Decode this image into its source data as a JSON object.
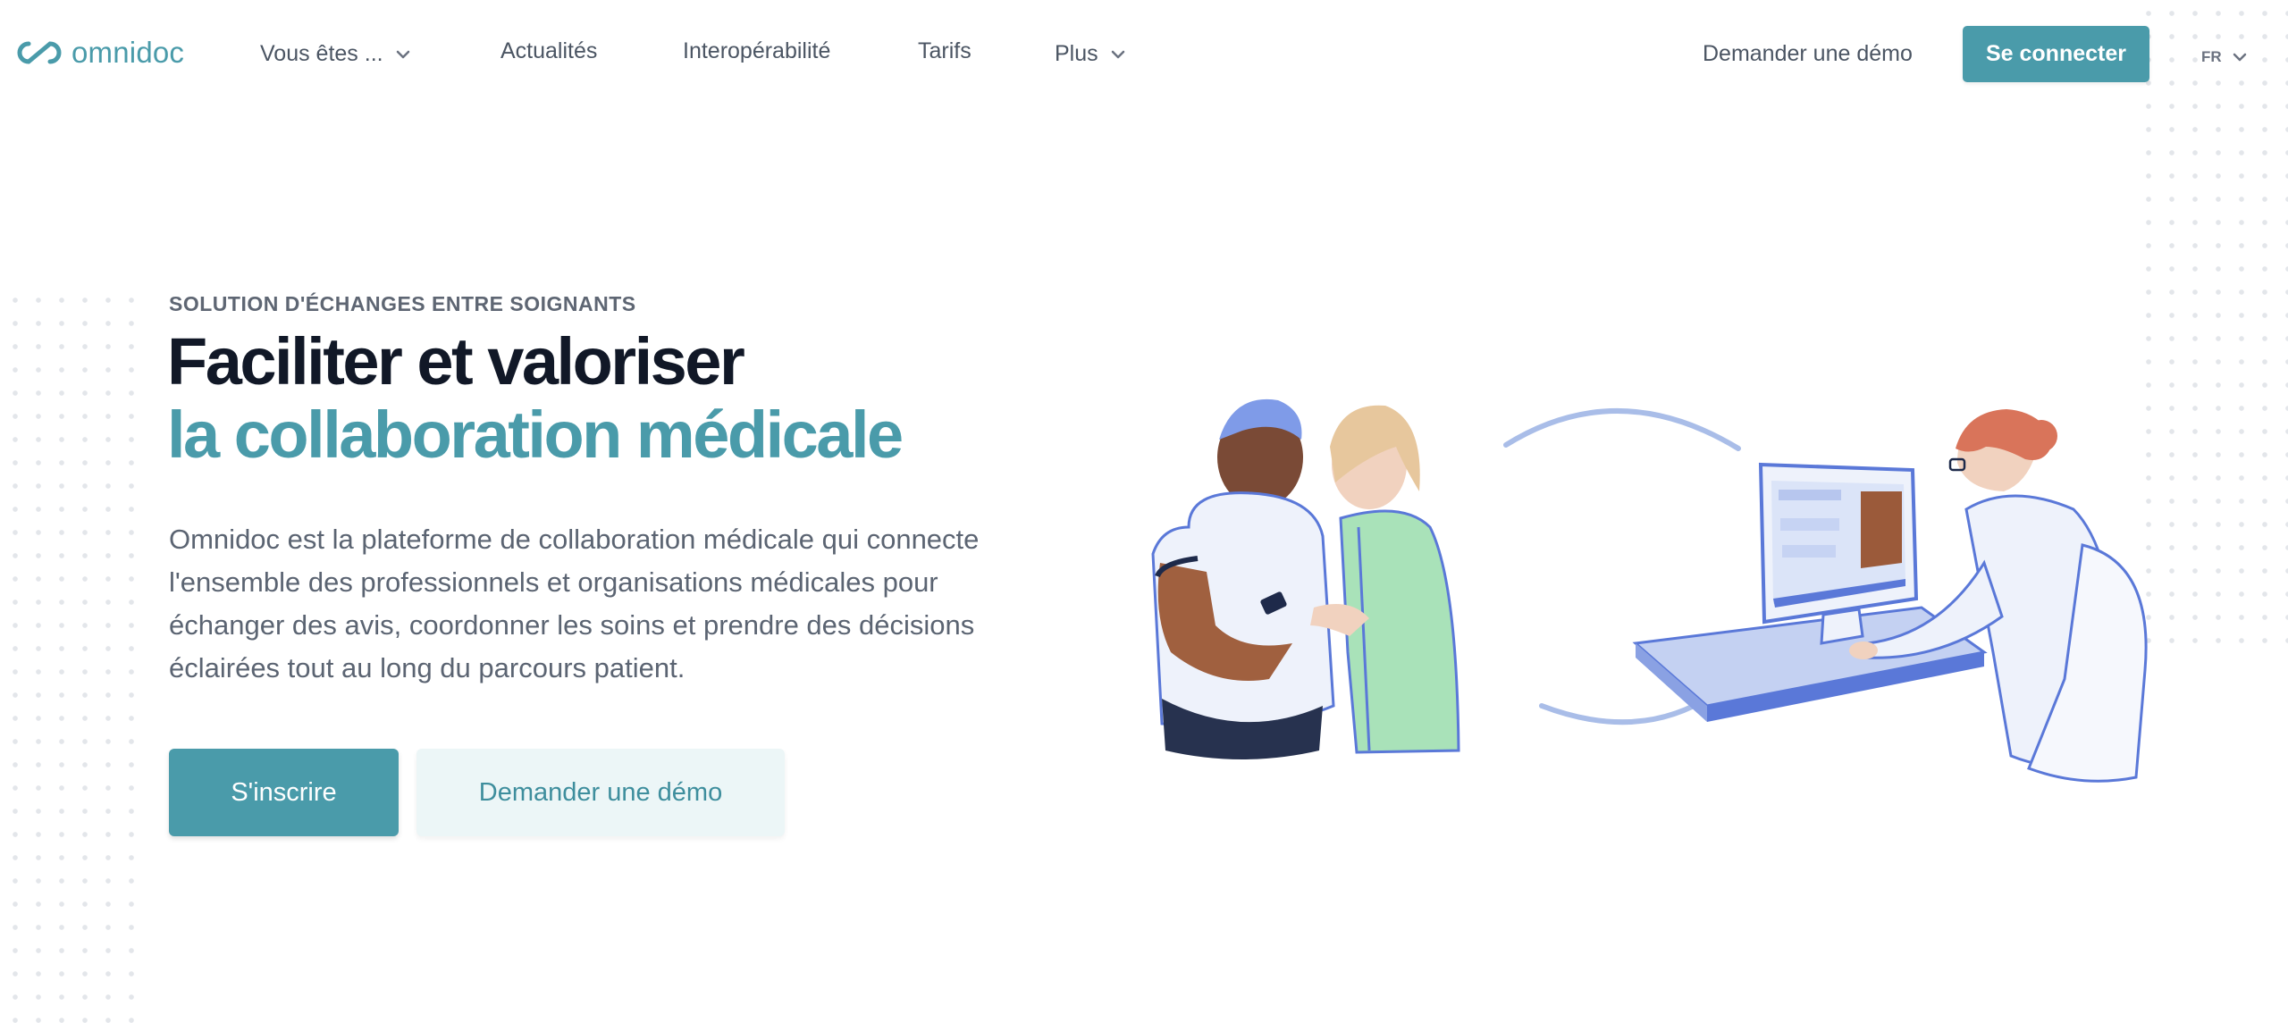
{
  "header": {
    "logo_text": "omnidoc",
    "nav": [
      {
        "label": "Vous êtes ...",
        "has_dropdown": true
      },
      {
        "label": "Actualités",
        "has_dropdown": false
      },
      {
        "label": "Interopérabilité",
        "has_dropdown": false
      },
      {
        "label": "Tarifs",
        "has_dropdown": false
      },
      {
        "label": "Plus",
        "has_dropdown": true
      }
    ],
    "demo_link": "Demander une démo",
    "login_button": "Se connecter",
    "language": "FR"
  },
  "hero": {
    "eyebrow": "SOLUTION D'ÉCHANGES ENTRE SOIGNANTS",
    "title_line1": "Faciliter et valoriser",
    "title_line2": "la collaboration médicale",
    "description": "Omnidoc est la plateforme de collaboration médicale qui connecte l'ensemble des professionnels et organisations médicales pour échanger des avis, coordonner les soins et prendre des décisions éclairées tout au long du parcours patient.",
    "primary_cta": "S'inscrire",
    "secondary_cta": "Demander une démo"
  },
  "colors": {
    "brand": "#4a9baa",
    "brand_light": "#ecf6f7",
    "heading": "#111827",
    "body_text": "#5b6472",
    "illustration_blue": "#5a78d8"
  },
  "icons": [
    "omnidoc-logo-icon",
    "chevron-down-icon"
  ]
}
